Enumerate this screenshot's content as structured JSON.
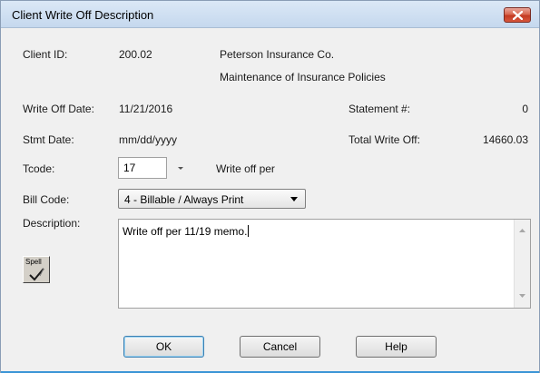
{
  "window": {
    "title": "Client Write Off Description"
  },
  "fields": {
    "client_id_label": "Client ID:",
    "client_id_value": "200.02",
    "client_name": "Peterson Insurance Co.",
    "client_matter": "Maintenance of Insurance Policies",
    "write_off_date_label": "Write Off Date:",
    "write_off_date_value": "11/21/2016",
    "statement_label": "Statement #:",
    "statement_value": "0",
    "stmt_date_label": "Stmt Date:",
    "stmt_date_value": "mm/dd/yyyy",
    "total_write_off_label": "Total Write Off:",
    "total_write_off_value": "14660.03",
    "tcode_label": "Tcode:",
    "tcode_value": "17",
    "tcode_description": "Write off per",
    "bill_code_label": "Bill Code:",
    "bill_code_value": "4 - Billable / Always Print",
    "description_label": "Description:",
    "description_value": "Write off per 11/19 memo."
  },
  "spell": {
    "label": "Spell",
    "icon": "spellcheck-icon"
  },
  "buttons": {
    "ok": "OK",
    "cancel": "Cancel",
    "help": "Help"
  },
  "colors": {
    "close_button": "#c33a22",
    "title_bar": "#c5d8ee",
    "dialog_bg": "#f0f0f0",
    "accent": "#3b95d6"
  }
}
